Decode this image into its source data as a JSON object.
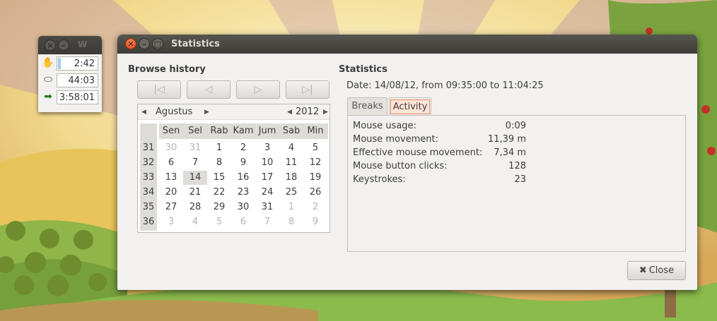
{
  "mini": {
    "title": "W",
    "timers": [
      {
        "icon": "hand-icon",
        "value": "2:42"
      },
      {
        "icon": "pause-icon",
        "value": "44:03"
      },
      {
        "icon": "exit-icon",
        "value": "3:58:01"
      }
    ]
  },
  "window": {
    "title": "Statistics",
    "close_glyph": "✕",
    "min_glyph": "–",
    "max_glyph": "□"
  },
  "browse": {
    "title": "Browse history",
    "nav": [
      "|◁",
      "◁",
      "▷",
      "▷|"
    ],
    "month": "Agustus",
    "year": "2012",
    "days_of_week": [
      "Sen",
      "Sel",
      "Rab",
      "Kam",
      "Jum",
      "Sab",
      "Min"
    ],
    "weeks": [
      {
        "week": "31",
        "days": [
          [
            "30",
            true
          ],
          [
            "31",
            true
          ],
          [
            "1",
            false
          ],
          [
            "2",
            false
          ],
          [
            "3",
            false
          ],
          [
            "4",
            false
          ],
          [
            "5",
            false
          ]
        ]
      },
      {
        "week": "32",
        "days": [
          [
            "6",
            false
          ],
          [
            "7",
            false
          ],
          [
            "8",
            false
          ],
          [
            "9",
            false
          ],
          [
            "10",
            false
          ],
          [
            "11",
            false
          ],
          [
            "12",
            false
          ]
        ]
      },
      {
        "week": "33",
        "days": [
          [
            "13",
            false
          ],
          [
            "14",
            false
          ],
          [
            "15",
            false
          ],
          [
            "16",
            false
          ],
          [
            "17",
            false
          ],
          [
            "18",
            false
          ],
          [
            "19",
            false
          ]
        ]
      },
      {
        "week": "34",
        "days": [
          [
            "20",
            false
          ],
          [
            "21",
            false
          ],
          [
            "22",
            false
          ],
          [
            "23",
            false
          ],
          [
            "24",
            false
          ],
          [
            "25",
            false
          ],
          [
            "26",
            false
          ]
        ]
      },
      {
        "week": "35",
        "days": [
          [
            "27",
            false
          ],
          [
            "28",
            false
          ],
          [
            "29",
            false
          ],
          [
            "30",
            false
          ],
          [
            "31",
            false
          ],
          [
            "1",
            true
          ],
          [
            "2",
            true
          ]
        ]
      },
      {
        "week": "36",
        "days": [
          [
            "3",
            true
          ],
          [
            "4",
            true
          ],
          [
            "5",
            true
          ],
          [
            "6",
            true
          ],
          [
            "7",
            true
          ],
          [
            "8",
            true
          ],
          [
            "9",
            true
          ]
        ]
      }
    ],
    "selected_day": "14"
  },
  "stats": {
    "title": "Statistics",
    "date_line": "Date:  14/08/12, from 09:35:00 to 11:04:25",
    "tabs": [
      "Breaks",
      "Activity"
    ],
    "active_tab": "Activity",
    "rows": [
      {
        "label": "Mouse usage:",
        "value": "0:09"
      },
      {
        "label": "Mouse movement:",
        "value": "11,39 m"
      },
      {
        "label": "Effective mouse movement:",
        "value": "7,34 m"
      },
      {
        "label": "Mouse button clicks:",
        "value": "128"
      },
      {
        "label": "Keystrokes:",
        "value": "23"
      }
    ],
    "close_label": "Close"
  },
  "colors": {
    "accent": "#e0461b",
    "tab_highlight": "#fde4d6",
    "selection": "#dedcd8"
  }
}
